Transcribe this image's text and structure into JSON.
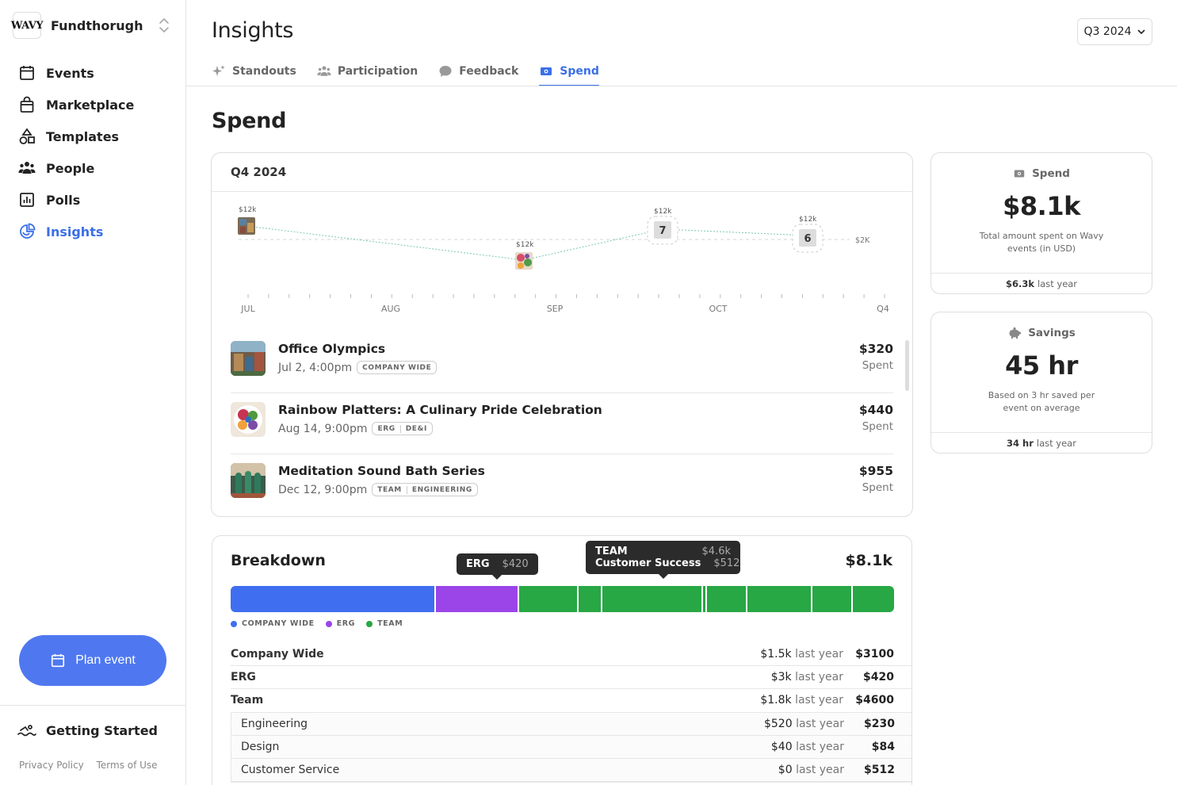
{
  "org": {
    "logo_text": "WAVY",
    "name": "Fundthorugh"
  },
  "nav": {
    "items": [
      {
        "label": "Events",
        "icon": "calendar-icon"
      },
      {
        "label": "Marketplace",
        "icon": "bag-icon"
      },
      {
        "label": "Templates",
        "icon": "shapes-icon"
      },
      {
        "label": "People",
        "icon": "people-icon"
      },
      {
        "label": "Polls",
        "icon": "poll-icon"
      },
      {
        "label": "Insights",
        "icon": "pie-chart-icon",
        "active": true
      }
    ],
    "plan_event": "Plan event",
    "getting_started": "Getting Started",
    "footer": {
      "privacy": "Privacy Policy",
      "terms": "Terms of Use"
    }
  },
  "header": {
    "title": "Insights",
    "period": "Q3 2024",
    "tabs": [
      {
        "label": "Standouts",
        "icon": "sparkle-icon"
      },
      {
        "label": "Participation",
        "icon": "people-icon"
      },
      {
        "label": "Feedback",
        "icon": "chat-bubble-icon"
      },
      {
        "label": "Spend",
        "icon": "money-icon",
        "active": true
      }
    ]
  },
  "section_title": "Spend",
  "events_card": {
    "title": "Q4 2024",
    "chart": {
      "x_labels": [
        "JUL",
        "AUG",
        "SEP",
        "OCT",
        "Q4"
      ],
      "baseline_label": "$2K",
      "points": [
        {
          "label": "$12k",
          "kind": "image"
        },
        {
          "label": "$12k",
          "kind": "image"
        },
        {
          "label": "$12k",
          "kind": "count",
          "count": "7"
        },
        {
          "label": "$12k",
          "kind": "count",
          "count": "6"
        }
      ]
    },
    "events": [
      {
        "title": "Office Olympics",
        "date": "Jul 2, 4:00pm",
        "tags": [
          "COMPANY WIDE"
        ],
        "amount": "$320",
        "sub": "Spent"
      },
      {
        "title": "Rainbow Platters: A Culinary Pride Celebration",
        "date": "Aug 14, 9:00pm",
        "tags": [
          "ERG",
          "DE&I"
        ],
        "amount": "$440",
        "sub": "Spent"
      },
      {
        "title": "Meditation Sound Bath Series",
        "date": "Dec 12, 9:00pm",
        "tags": [
          "TEAM",
          "ENGINEERING"
        ],
        "amount": "$955",
        "sub": "Spent"
      }
    ]
  },
  "stats": {
    "spend": {
      "label": "Spend",
      "value": "$8.1k",
      "desc": "Total amount spent on Wavy events (in USD)",
      "last_year_value": "$6.3k",
      "last_year_label": "last year"
    },
    "savings": {
      "label": "Savings",
      "value": "45 hr",
      "desc": "Based on 3 hr saved per event on average",
      "last_year_value": "34 hr",
      "last_year_label": "last year"
    }
  },
  "breakdown": {
    "title": "Breakdown",
    "total": "$8.1k",
    "colors": {
      "company_wide": "#3f6ef0",
      "erg": "#9b45e8",
      "team": "#28a745"
    },
    "segments_share": [
      {
        "group": "company_wide",
        "value": 3100
      },
      {
        "group": "erg",
        "value": 1250
      },
      {
        "group": "team",
        "value": 900
      },
      {
        "group": "team",
        "value": 360
      },
      {
        "group": "team",
        "value": 1520
      },
      {
        "group": "team",
        "value": 60
      },
      {
        "group": "team",
        "value": 610
      },
      {
        "group": "team",
        "value": 980
      },
      {
        "group": "team",
        "value": 610
      },
      {
        "group": "team",
        "value": 620
      }
    ],
    "legend": [
      {
        "label": "COMPANY WIDE",
        "group": "company_wide"
      },
      {
        "label": "ERG",
        "group": "erg"
      },
      {
        "label": "TEAM",
        "group": "team"
      }
    ],
    "tooltip_erg": {
      "key": "ERG",
      "value": "$420"
    },
    "tooltip_team": {
      "key1": "TEAM",
      "value1": "$4.6k",
      "key2": "Customer Success",
      "value2": "$512"
    },
    "last_year_word": "last year",
    "rows": [
      {
        "name": "Company Wide",
        "last_year": "$1.5k",
        "amount": "$3100"
      },
      {
        "name": "ERG",
        "last_year": "$3k",
        "amount": "$420"
      },
      {
        "name": "Team",
        "last_year": "$1.8k",
        "amount": "$4600"
      }
    ],
    "team_rows": [
      {
        "name": "Engineering",
        "last_year": "$520",
        "amount": "$230"
      },
      {
        "name": "Design",
        "last_year": "$40",
        "amount": "$84"
      },
      {
        "name": "Customer Service",
        "last_year": "$0",
        "amount": "$512"
      }
    ]
  }
}
